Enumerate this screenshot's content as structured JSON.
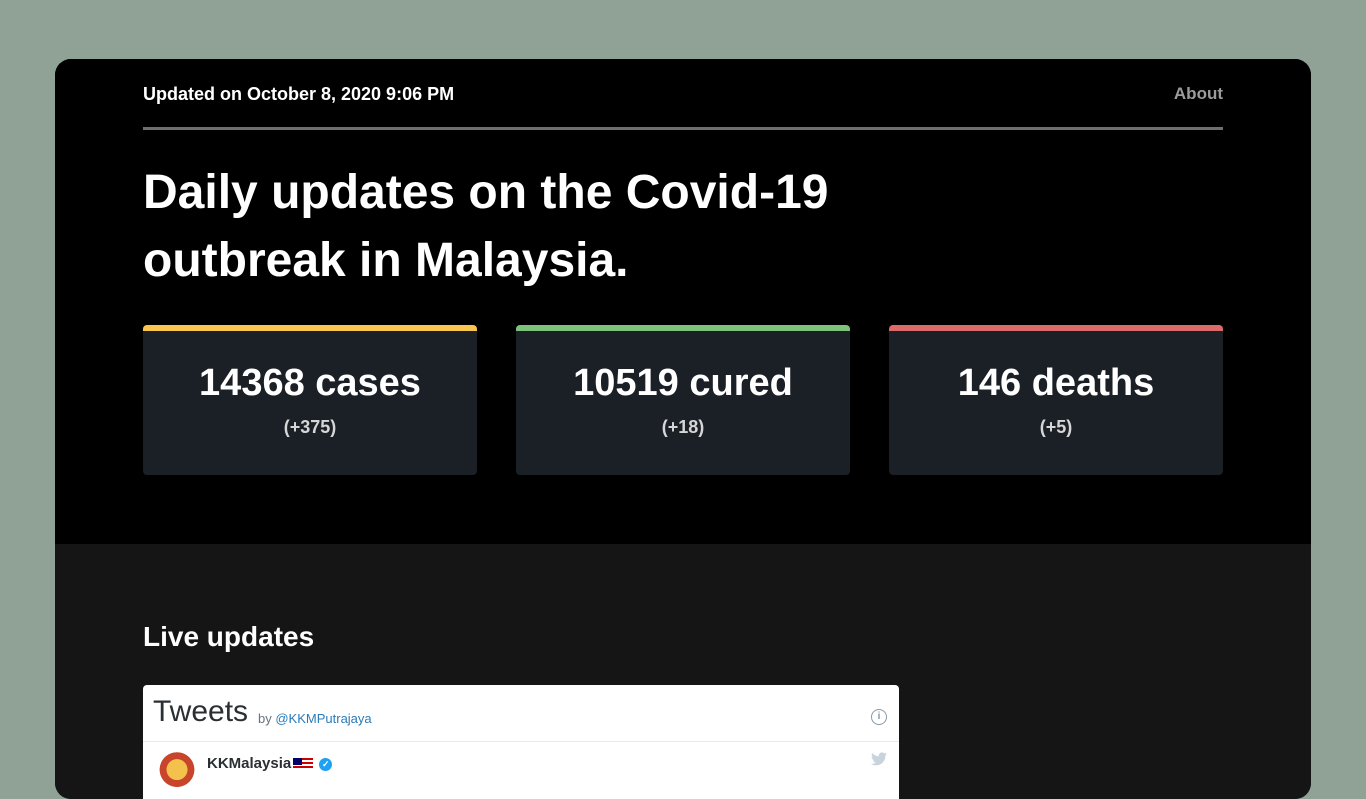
{
  "header": {
    "updated": "Updated on October 8, 2020 9:06 PM",
    "about_label": "About"
  },
  "hero": {
    "headline": "Daily updates on the Covid-19 outbreak in Malaysia."
  },
  "stats": [
    {
      "main": "14368 cases",
      "delta": "(+375)",
      "accent": "#f8c64e"
    },
    {
      "main": "10519 cured",
      "delta": "(+18)",
      "accent": "#7dc27a"
    },
    {
      "main": "146 deaths",
      "delta": "(+5)",
      "accent": "#dd6a6a"
    }
  ],
  "live": {
    "title": "Live updates",
    "widget": {
      "title": "Tweets",
      "by_label": "by",
      "handle": "@KKMPutrajaya",
      "account_name": "KKMalaysia",
      "info_icon": "info-icon",
      "bird_icon": "twitter-bird-icon"
    }
  },
  "colors": {
    "page_bg": "#8fa295",
    "hero_bg": "#000000",
    "live_bg": "#151515",
    "card_bg": "#1b1f26"
  }
}
